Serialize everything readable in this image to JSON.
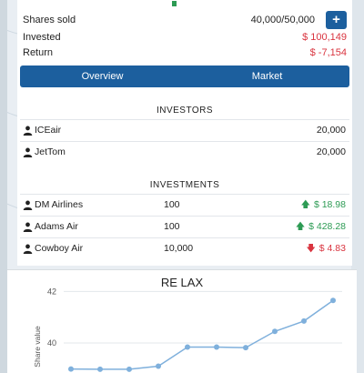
{
  "summary": {
    "shares_label": "Shares sold",
    "shares_value": "40,000/50,000",
    "add_label": "+",
    "invested_label": "Invested",
    "invested_value": "$ 100,149",
    "return_label": "Return",
    "return_value": "$ -7,154"
  },
  "tabs": [
    {
      "label": "Overview"
    },
    {
      "label": "Market"
    }
  ],
  "investors": {
    "title": "INVESTORS",
    "rows": [
      {
        "name": "ICEair",
        "amount": "20,000"
      },
      {
        "name": "JetTom",
        "amount": "20,000"
      }
    ]
  },
  "investments": {
    "title": "INVESTMENTS",
    "rows": [
      {
        "name": "DM Airlines",
        "qty": "100",
        "arrow": "up",
        "value": "$ 18.98"
      },
      {
        "name": "Adams Air",
        "qty": "100",
        "arrow": "up",
        "value": "$ 428.28"
      },
      {
        "name": "Cowboy Air",
        "qty": "10,000",
        "arrow": "down",
        "value": "$ 4.83"
      }
    ]
  },
  "colors": {
    "primary": "#1c5f9e",
    "positive": "#2d9b54",
    "negative": "#d9343f",
    "line": "#7fb0dc"
  },
  "chart_data": {
    "type": "line",
    "title": "RE LAX",
    "ylabel": "Share value",
    "xlabel": "",
    "yticks": [
      40,
      42
    ],
    "ylim": [
      38.8,
      42.4
    ],
    "grid": true,
    "series": [
      {
        "values": [
          38.99,
          38.98,
          38.98,
          39.1,
          39.84,
          39.84,
          39.82,
          40.45,
          40.85,
          41.65
        ]
      }
    ]
  }
}
